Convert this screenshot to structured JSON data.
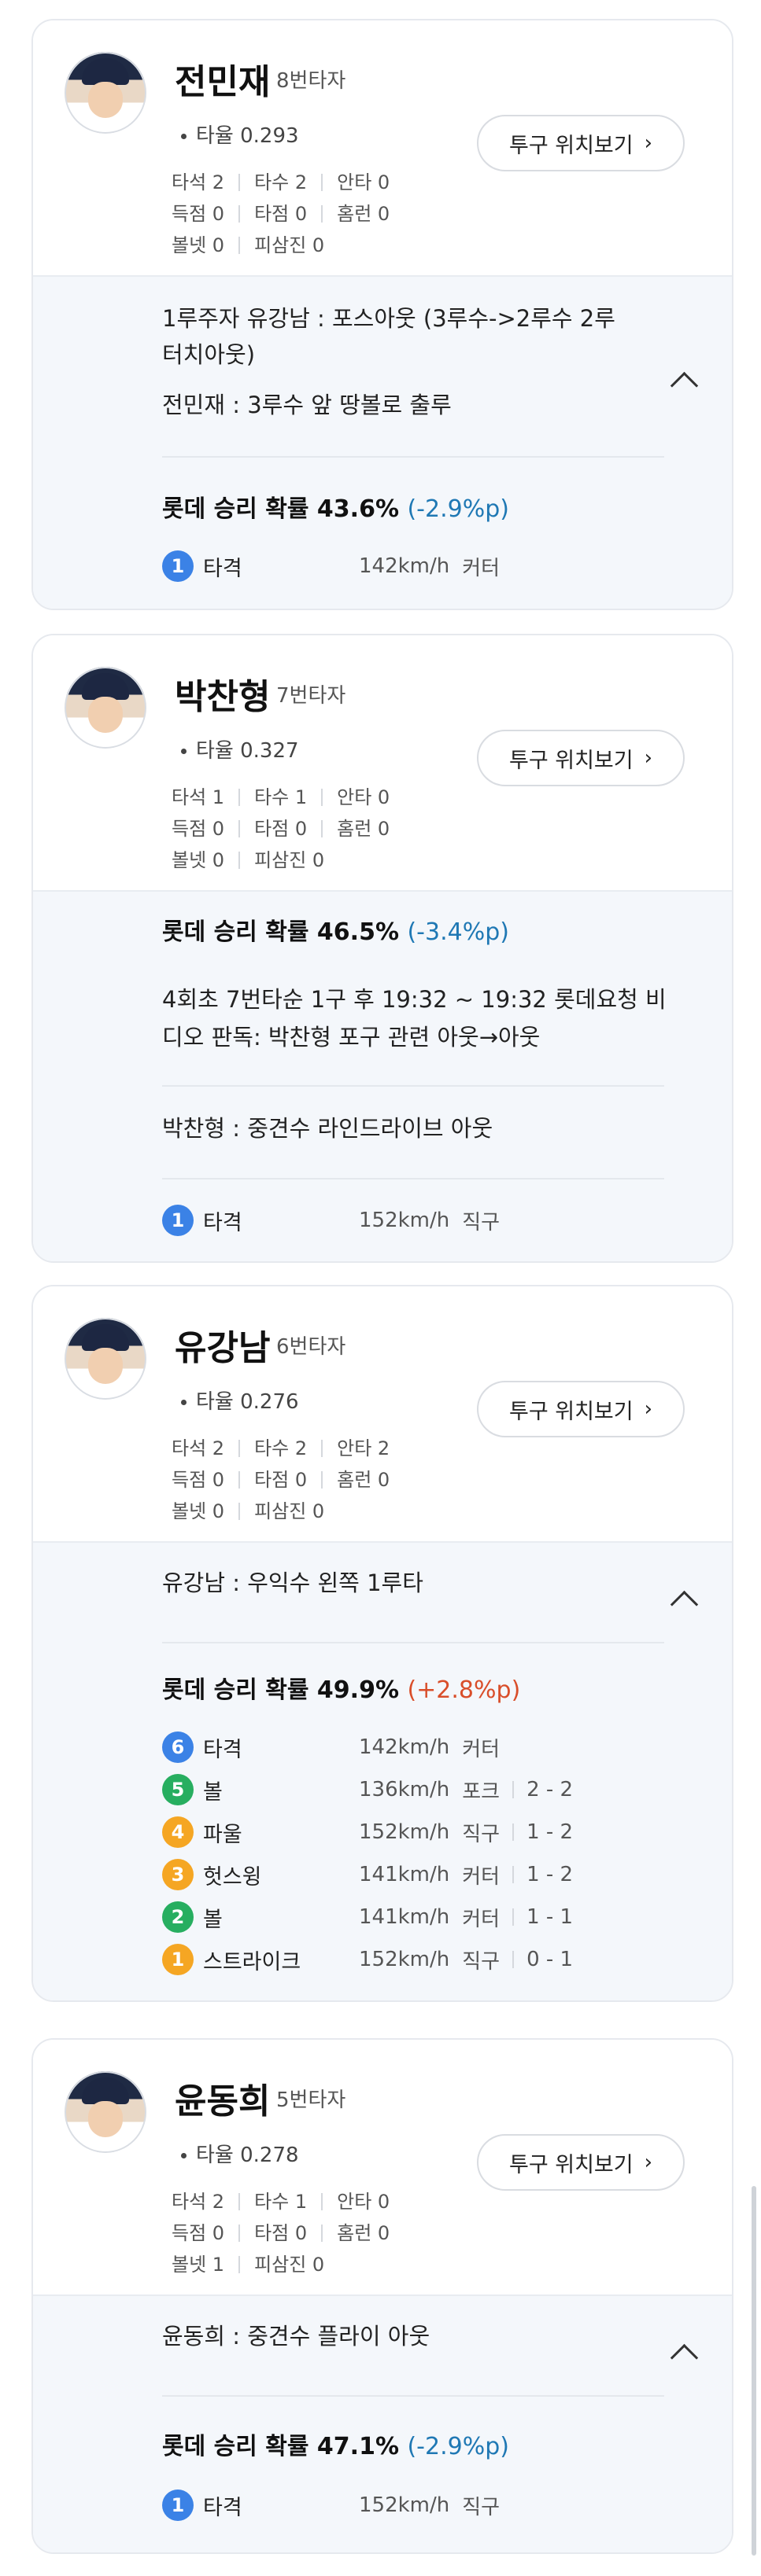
{
  "button_label": "투구 위치보기",
  "players": [
    {
      "name": "전민재",
      "order": "8번타자",
      "avg": "타율 0.293",
      "stats": [
        [
          "타석 2",
          "타수 2",
          "안타 0"
        ],
        [
          "득점 0",
          "타점 0",
          "홈런 0"
        ],
        [
          "볼넷 0",
          "피삼진 0"
        ]
      ],
      "events": [
        "1루주자 유강남 : 포스아웃 (3루수->2루수 2루",
        "터치아웃)",
        "전민재 : 3루수 앞 땅볼로 출루"
      ],
      "win_label": "롯데 승리 확률 43.6%",
      "win_change": "(-2.9%p)",
      "pitches": [
        {
          "n": "1",
          "type": "타격",
          "speed": "142km/h",
          "kind": "커터",
          "count": ""
        }
      ]
    },
    {
      "name": "박찬형",
      "order": "7번타자",
      "avg": "타율 0.327",
      "stats": [
        [
          "타석 1",
          "타수 1",
          "안타 0"
        ],
        [
          "득점 0",
          "타점 0",
          "홈런 0"
        ],
        [
          "볼넷 0",
          "피삼진 0"
        ]
      ],
      "win_label": "롯데 승리 확률 46.5%",
      "win_change": "(-3.4%p)",
      "events": [
        "4회초 7번타순 1구 후 19:32 ~ 19:32 롯데요청 비",
        "디오 판독: 박찬형 포구 관련 아웃→아웃",
        "박찬형 : 중견수 라인드라이브 아웃"
      ],
      "pitches": [
        {
          "n": "1",
          "type": "타격",
          "speed": "152km/h",
          "kind": "직구",
          "count": ""
        }
      ]
    },
    {
      "name": "유강남",
      "order": "6번타자",
      "avg": "타율 0.276",
      "stats": [
        [
          "타석 2",
          "타수 2",
          "안타 2"
        ],
        [
          "득점 0",
          "타점 0",
          "홈런 0"
        ],
        [
          "볼넷 0",
          "피삼진 0"
        ]
      ],
      "events": [
        "유강남 : 우익수 왼쪽 1루타"
      ],
      "win_label": "롯데 승리 확률 49.9%",
      "win_change": "(+2.8%p)",
      "pitches": [
        {
          "n": "6",
          "type": "타격",
          "speed": "142km/h",
          "kind": "커터",
          "count": ""
        },
        {
          "n": "5",
          "type": "볼",
          "speed": "136km/h",
          "kind": "포크",
          "count": "2 - 2"
        },
        {
          "n": "4",
          "type": "파울",
          "speed": "152km/h",
          "kind": "직구",
          "count": "1 - 2"
        },
        {
          "n": "3",
          "type": "헛스윙",
          "speed": "141km/h",
          "kind": "커터",
          "count": "1 - 2"
        },
        {
          "n": "2",
          "type": "볼",
          "speed": "141km/h",
          "kind": "커터",
          "count": "1 - 1"
        },
        {
          "n": "1",
          "type": "스트라이크",
          "speed": "152km/h",
          "kind": "직구",
          "count": "0 - 1"
        }
      ]
    },
    {
      "name": "윤동희",
      "order": "5번타자",
      "avg": "타율 0.278",
      "stats": [
        [
          "타석 2",
          "타수 1",
          "안타 0"
        ],
        [
          "득점 0",
          "타점 0",
          "홈런 0"
        ],
        [
          "볼넷 1",
          "피삼진 0"
        ]
      ],
      "events": [
        "윤동희 : 중견수 플라이 아웃"
      ],
      "win_label": "롯데 승리 확률 47.1%",
      "win_change": "(-2.9%p)",
      "pitches": [
        {
          "n": "1",
          "type": "타격",
          "speed": "152km/h",
          "kind": "직구",
          "count": ""
        }
      ]
    }
  ]
}
